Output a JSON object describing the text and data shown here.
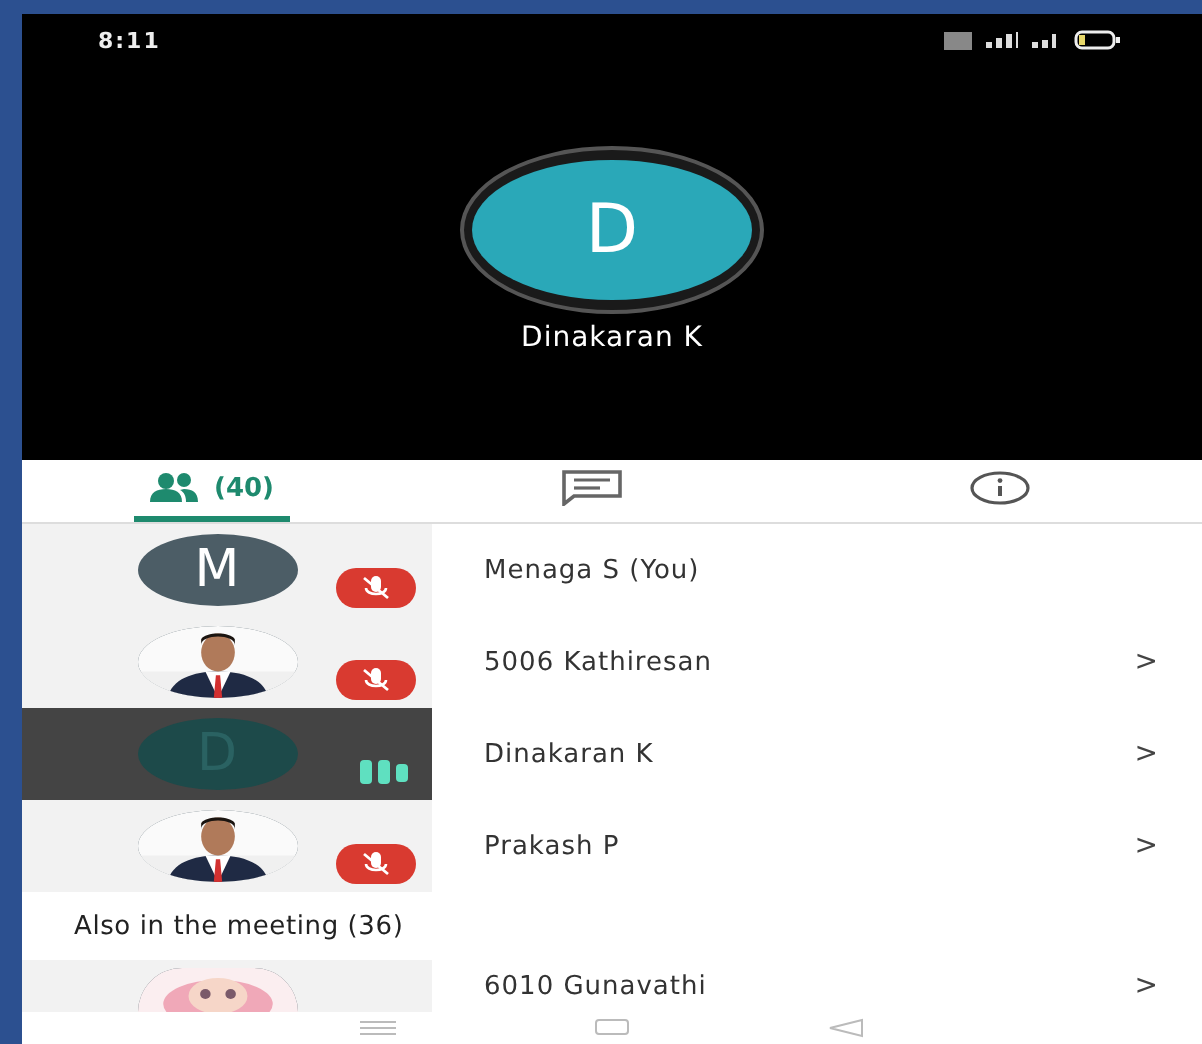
{
  "status_bar": {
    "time": "8:11"
  },
  "speaker": {
    "initial": "D",
    "name": "Dinakaran K"
  },
  "tabs": [
    {
      "kind": "people",
      "label": "(40)",
      "selected": true
    },
    {
      "kind": "chat",
      "selected": false
    },
    {
      "kind": "info",
      "selected": false
    }
  ],
  "participants": [
    {
      "kind": "letter",
      "initial": "M",
      "name": "Menaga S (You)",
      "muted": true,
      "speaking": false
    },
    {
      "kind": "picture",
      "name": "5006 Kathiresan",
      "muted": true,
      "speaking": false,
      "chevron": ">"
    },
    {
      "kind": "letter",
      "initial": "D",
      "name": "Dinakaran K",
      "muted": false,
      "speaking": true,
      "chevron": ">"
    },
    {
      "kind": "picture",
      "name": "Prakash P",
      "muted": true,
      "speaking": false,
      "chevron": ">"
    }
  ],
  "also_section": {
    "title": "Also in the meeting (36)",
    "participants": [
      {
        "kind": "picture",
        "name": "6010 Gunavathi",
        "chevron": ">"
      }
    ]
  }
}
